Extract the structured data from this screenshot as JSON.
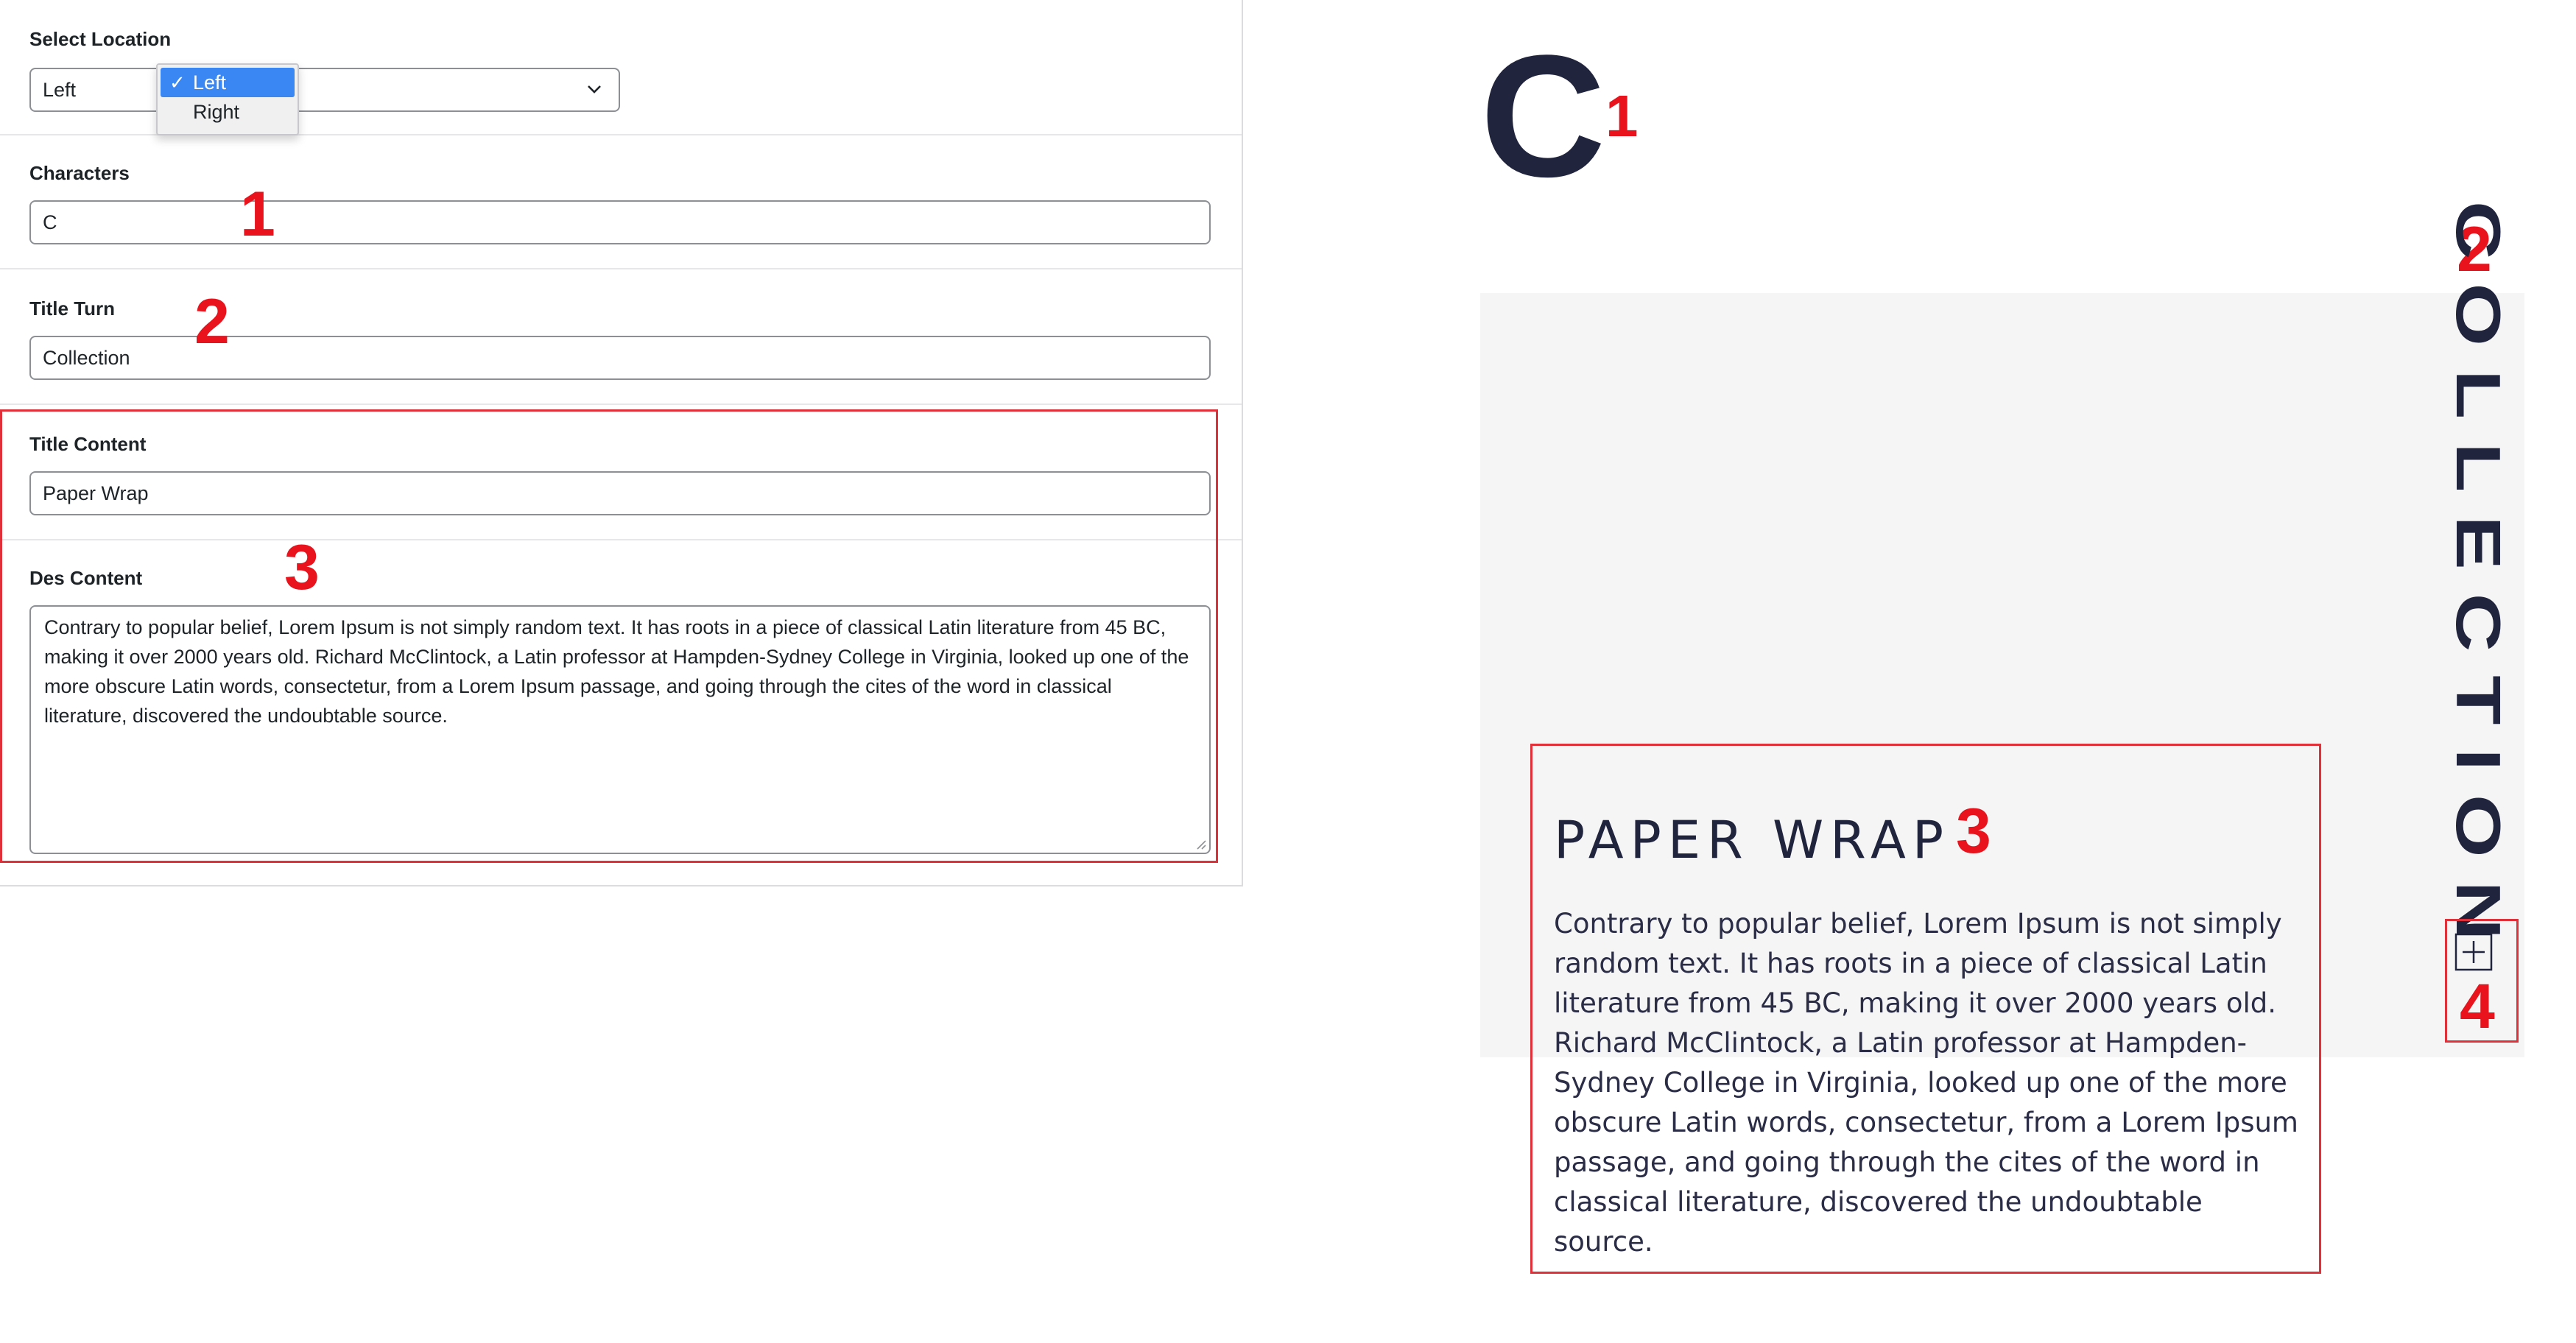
{
  "settings": {
    "location": {
      "label": "Select Location",
      "value": "Left",
      "options": [
        "Left",
        "Right"
      ],
      "check_icon": "checkmark-icon"
    },
    "characters": {
      "label": "Characters",
      "value": "C"
    },
    "title_turn": {
      "label": "Title Turn",
      "value": "Collection"
    },
    "title_content": {
      "label": "Title Content",
      "value": "Paper Wrap"
    },
    "des_content": {
      "label": "Des Content",
      "value": "Contrary to popular belief, Lorem Ipsum is not simply random text. It has roots in a piece of classical Latin literature from 45 BC, making it over 2000 years old. Richard McClintock, a Latin professor at Hampden-Sydney College in Virginia, looked up one of the more obscure Latin words, consectetur, from a Lorem Ipsum passage, and going through the cites of the word in classical literature, discovered the undoubtable source."
    }
  },
  "preview": {
    "character": "C",
    "vertical_title": "Collection",
    "card_title": "Paper Wrap",
    "card_body": "Contrary to popular belief, Lorem Ipsum is not simply random text. It has roots in a piece of classical Latin literature from 45 BC, making it over 2000 years old. Richard McClintock, a Latin professor at Hampden-Sydney College in Virginia, looked up one of the more obscure Latin words, consectetur, from a Lorem Ipsum passage, and going through the cites of the word in classical literature, discovered the undoubtable source.",
    "plus_icon": "plus-box-icon"
  },
  "annotations": {
    "n1": "1",
    "n2": "2",
    "n3": "3",
    "n4": "4",
    "color": "#e8131c"
  },
  "colors": {
    "accent_dark": "#21243d",
    "highlight_red": "#e0313a",
    "select_blue": "#3a87f4",
    "preview_bg": "#f5f5f6"
  }
}
